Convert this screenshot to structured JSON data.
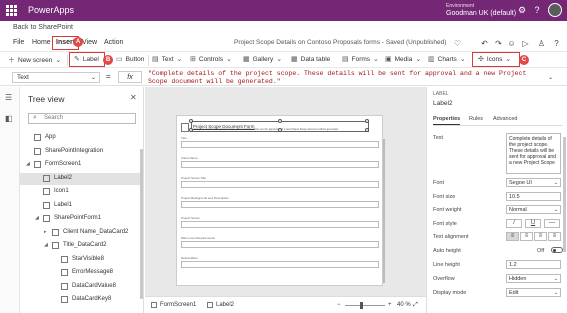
{
  "app": {
    "name": "PowerApps",
    "environment_label": "Environment",
    "environment_name": "Goodman UK (default)"
  },
  "back_link": "Back to SharePoint",
  "menu": {
    "items": [
      "File",
      "Home",
      "Insert",
      "View",
      "Action"
    ],
    "active": "Insert",
    "doc_title": "Project Scope Details on Contoso Proposals forms - Saved (Unpublished)"
  },
  "callouts": {
    "a": "A",
    "b": "B",
    "c": "C"
  },
  "toolbar": {
    "new_screen": "New screen",
    "label": "Label",
    "button": "Button",
    "text": "Text",
    "controls": "Controls",
    "gallery": "Gallery",
    "data_table": "Data table",
    "forms": "Forms",
    "media": "Media",
    "charts": "Charts",
    "icons": "Icons",
    "ai_builder": "AI Builder"
  },
  "formula_bar": {
    "property": "Text",
    "equals": "=",
    "fx": "fx",
    "formula": "\"Complete details of the project scope. These details will be sent for approval and a new Project Scope document will be generated.\""
  },
  "tree_view": {
    "title": "Tree view",
    "search_placeholder": "Search",
    "items": [
      {
        "label": "App",
        "indent": 0,
        "icon": "app-icon",
        "expand": ""
      },
      {
        "label": "SharePointIntegration",
        "indent": 0,
        "icon": "sharepoint-icon",
        "expand": ""
      },
      {
        "label": "FormScreen1",
        "indent": 0,
        "icon": "screen-icon",
        "expand": "◢"
      },
      {
        "label": "Label2",
        "indent": 1,
        "icon": "label-icon",
        "expand": "",
        "selected": true
      },
      {
        "label": "Icon1",
        "indent": 1,
        "icon": "icon-icon",
        "expand": ""
      },
      {
        "label": "Label1",
        "indent": 1,
        "icon": "label-icon",
        "expand": ""
      },
      {
        "label": "SharePointForm1",
        "indent": 1,
        "icon": "form-icon",
        "expand": "◢"
      },
      {
        "label": "Client Name_DataCard2",
        "indent": 2,
        "icon": "card-icon",
        "expand": "▸"
      },
      {
        "label": "Title_DataCard2",
        "indent": 2,
        "icon": "card-icon",
        "expand": "◢"
      },
      {
        "label": "StarVisible8",
        "indent": 3,
        "icon": "label-icon",
        "expand": ""
      },
      {
        "label": "ErrorMessage8",
        "indent": 3,
        "icon": "label-icon",
        "expand": ""
      },
      {
        "label": "DataCardValue8",
        "indent": 3,
        "icon": "input-icon",
        "expand": ""
      },
      {
        "label": "DataCardKey8",
        "indent": 3,
        "icon": "label-icon",
        "expand": ""
      }
    ]
  },
  "canvas": {
    "form_title": "Project Scope Document Form",
    "selected_label_text": "Complete details of the project scope. These details will be sent for approval and a new Project Scope document will be generated.",
    "fields": [
      "Title",
      "Client Name",
      "Project Scope Title",
      "Project Background and Description",
      "Project Scope",
      "Main Level Requirements",
      "Deliverables"
    ]
  },
  "status_bar": {
    "screen": "FormScreen1",
    "control": "Label2",
    "minus": "−",
    "plus": "+",
    "zoom": "40 %",
    "zoom_fraction": 0.4
  },
  "properties": {
    "kind": "LABEL",
    "name": "Label2",
    "tabs": [
      "Properties",
      "Rules",
      "Advanced"
    ],
    "active_tab": "Properties",
    "rows": {
      "text_label": "Text",
      "text_value": "Complete details of the project scope. These details will be sent for approval and a new Project Scope",
      "font_label": "Font",
      "font_value": "Segoe UI",
      "font_size_label": "Font size",
      "font_size_value": "10.5",
      "font_weight_label": "Font weight",
      "font_weight_value": "Normal",
      "font_style_label": "Font style",
      "font_style_buttons": [
        "/",
        "U",
        "—"
      ],
      "text_alignment_label": "Text alignment",
      "auto_height_label": "Auto height",
      "auto_height_value": "Off",
      "line_height_label": "Line height",
      "line_height_value": "1.2",
      "overflow_label": "Overflow",
      "overflow_value": "Hidden",
      "display_mode_label": "Display mode",
      "display_mode_value": "Edit"
    }
  },
  "colors": {
    "brand": "#742774",
    "callout": "#e04a4a",
    "formula_text": "#a31515"
  }
}
